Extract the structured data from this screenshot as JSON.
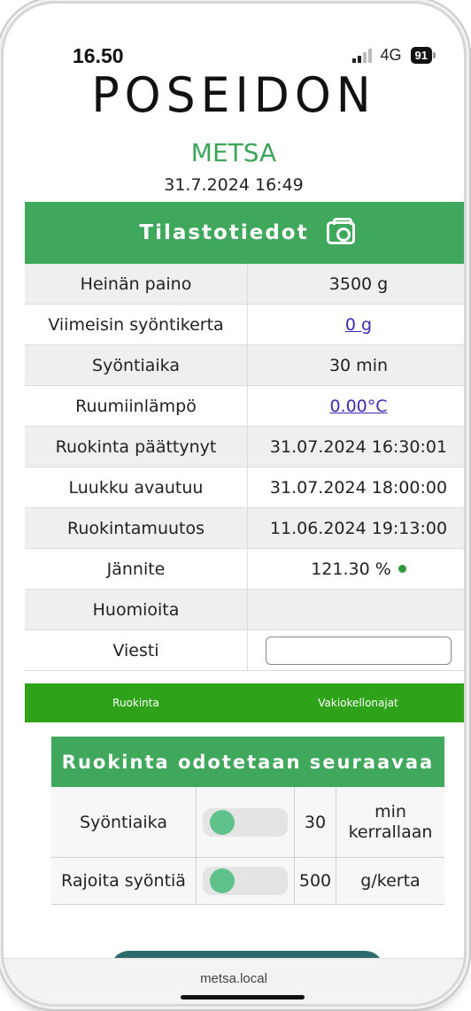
{
  "status_bar": {
    "time": "16.50",
    "network": "4G",
    "battery": "91"
  },
  "header": {
    "brand": "POSEIDON",
    "subtitle": "METSA",
    "datetime": "31.7.2024 16:49"
  },
  "stats": {
    "title": "Tilastotiedot",
    "rows": [
      {
        "label": "Heinän paino",
        "value": "3500 g"
      },
      {
        "label": "Viimeisin syöntikerta",
        "value": "0 g"
      },
      {
        "label": "Syöntiaika",
        "value": "30 min"
      },
      {
        "label": "Ruumiinlämpö",
        "value": "0.00°C"
      },
      {
        "label": "Ruokinta päättynyt",
        "value": "31.07.2024 16:30:01"
      },
      {
        "label": "Luukku avautuu",
        "value": "31.07.2024 18:00:00"
      },
      {
        "label": "Ruokintamuutos",
        "value": "11.06.2024 19:13:00"
      },
      {
        "label": "Jännite",
        "value": "121.30 %"
      },
      {
        "label": "Huomioita",
        "value": ""
      },
      {
        "label": "Viesti",
        "value": ""
      }
    ]
  },
  "nav": {
    "left": "Ruokinta",
    "right": "Vakiokellonajat"
  },
  "feeding": {
    "title": "Ruokinta odotetaan seuraavaa",
    "rows": [
      {
        "label": "Syöntiaika",
        "value": "30",
        "unit": "min kerrallaan"
      },
      {
        "label": "Rajoita syöntiä",
        "value": "500",
        "unit": "g/kerta"
      }
    ]
  },
  "browser": {
    "url": "metsa.local"
  },
  "colors": {
    "accent": "#40a85d",
    "nav": "#2ea31a",
    "link": "#3a2bb8"
  }
}
